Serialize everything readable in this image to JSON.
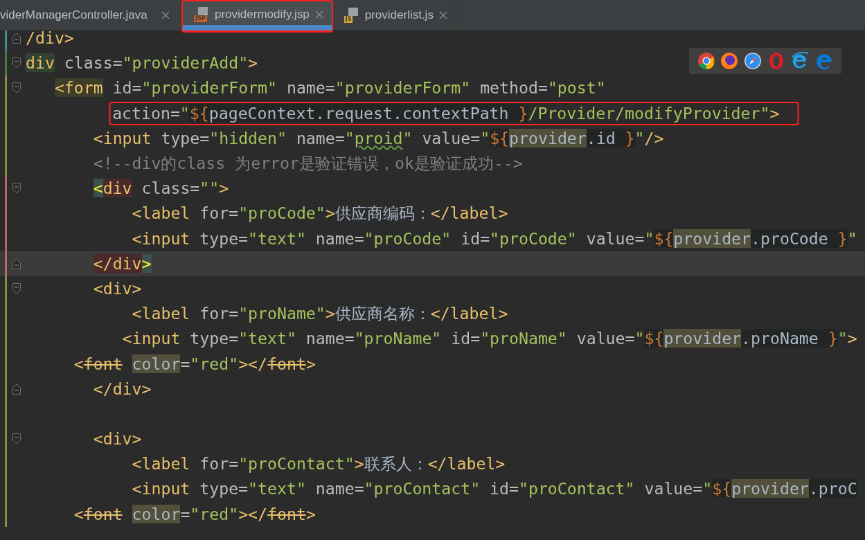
{
  "tabs": [
    {
      "label": "viderManagerController.java",
      "selected": false,
      "annotated": false
    },
    {
      "label": "providermodify.jsp",
      "icon_label": "JSP",
      "color": "#c8602a",
      "selected": true,
      "annotated": true
    },
    {
      "label": "providerlist.js",
      "icon_label": "JS",
      "color": "#d9a63a",
      "selected": false,
      "annotated": false
    }
  ],
  "lines": [
    {
      "kind": "code",
      "color": "#3e8f8f",
      "fold_start": false,
      "fold_end": true,
      "current": false,
      "annotated": false,
      "tokens": [
        {
          "kind": "tag",
          "text": "/div>"
        }
      ]
    },
    {
      "kind": "code",
      "color": "#4a7a45",
      "fold_start": true,
      "fold_end": false,
      "current": false,
      "annotated": false,
      "tokens": [
        {
          "kind": "tagsel",
          "text": "div"
        },
        {
          "kind": "attr",
          "text": " class="
        },
        {
          "kind": "str",
          "text": "\"providerAdd\""
        },
        {
          "kind": "tag",
          "text": ">"
        }
      ]
    },
    {
      "kind": "code",
      "color": "#8d8a4a",
      "fold_start": true,
      "fold_end": false,
      "current": false,
      "annotated": false,
      "tokens": [
        {
          "kind": "tagmark",
          "text": "<form"
        },
        {
          "kind": "attr",
          "text": " id="
        },
        {
          "kind": "str",
          "text": "\"providerForm\""
        },
        {
          "kind": "attr",
          "text": " name="
        },
        {
          "kind": "str",
          "text": "\"providerForm\""
        },
        {
          "kind": "attr",
          "text": " method="
        },
        {
          "kind": "str",
          "text": "\"post\""
        }
      ]
    },
    {
      "kind": "code",
      "color": "#8d8a4a",
      "fold_start": false,
      "fold_end": false,
      "current": false,
      "annotated": true,
      "tokens": [
        {
          "kind": "attr",
          "text": "action="
        },
        {
          "kind": "str",
          "text": "\""
        },
        {
          "kind": "elb",
          "text": "${"
        },
        {
          "kind": "eli",
          "text": "pageContext.request.contextPath "
        },
        {
          "kind": "elb",
          "text": "}"
        },
        {
          "kind": "str",
          "text": "/Provider/modifyProvider\""
        },
        {
          "kind": "tag",
          "text": ">"
        }
      ]
    },
    {
      "kind": "code",
      "color": "#8d8a4a",
      "fold_start": false,
      "fold_end": false,
      "current": false,
      "annotated": false,
      "tokens": [
        {
          "kind": "tag",
          "text": "<input"
        },
        {
          "kind": "attr",
          "text": " type="
        },
        {
          "kind": "str",
          "text": "\"hidden\""
        },
        {
          "kind": "attr",
          "text": " name="
        },
        {
          "kind": "str",
          "text": "\""
        },
        {
          "kind": "typo",
          "text": "proid"
        },
        {
          "kind": "str",
          "text": "\""
        },
        {
          "kind": "attr",
          "text": " value="
        },
        {
          "kind": "str",
          "text": "\""
        },
        {
          "kind": "elb",
          "text": "${"
        },
        {
          "kind": "use",
          "text": "provider"
        },
        {
          "kind": "eli",
          "text": ".id "
        },
        {
          "kind": "elb",
          "text": "}"
        },
        {
          "kind": "str",
          "text": "\""
        },
        {
          "kind": "tag",
          "text": "/>"
        }
      ]
    },
    {
      "kind": "code",
      "color": "#8d8a4a",
      "fold_start": false,
      "fold_end": false,
      "current": false,
      "annotated": false,
      "tokens": [
        {
          "kind": "cmt",
          "text": "<!--div的class 为error是验证错误，ok是验证成功-->"
        }
      ]
    },
    {
      "kind": "code",
      "color": "#b06a6a",
      "fold_start": true,
      "fold_end": false,
      "current": false,
      "annotated": false,
      "tokens": [
        {
          "kind": "matchb",
          "text": "<"
        },
        {
          "kind": "matchn",
          "text": "div"
        },
        {
          "kind": "attr",
          "text": " class="
        },
        {
          "kind": "str",
          "text": "\"\""
        },
        {
          "kind": "tag",
          "text": ">"
        }
      ]
    },
    {
      "kind": "code",
      "color": "#b06a6a",
      "fold_start": false,
      "fold_end": false,
      "current": false,
      "annotated": false,
      "tokens": [
        {
          "kind": "tag",
          "text": "<label"
        },
        {
          "kind": "attr",
          "text": " for="
        },
        {
          "kind": "str",
          "text": "\"proCode\""
        },
        {
          "kind": "tag",
          "text": ">"
        },
        {
          "kind": "txt",
          "text": "供应商编码："
        },
        {
          "kind": "tag",
          "text": "</label>"
        }
      ]
    },
    {
      "kind": "code",
      "color": "#b06a6a",
      "fold_start": false,
      "fold_end": false,
      "current": false,
      "annotated": false,
      "tokens": [
        {
          "kind": "tag",
          "text": "<input"
        },
        {
          "kind": "attr",
          "text": " type="
        },
        {
          "kind": "str",
          "text": "\"text\""
        },
        {
          "kind": "attr",
          "text": " name="
        },
        {
          "kind": "str",
          "text": "\"proCode\""
        },
        {
          "kind": "attr",
          "text": " id="
        },
        {
          "kind": "str",
          "text": "\"proCode\""
        },
        {
          "kind": "attr",
          "text": " value="
        },
        {
          "kind": "str",
          "text": "\""
        },
        {
          "kind": "elb",
          "text": "${"
        },
        {
          "kind": "use",
          "text": "provider"
        },
        {
          "kind": "eli",
          "text": ".proCode "
        },
        {
          "kind": "elb",
          "text": "}"
        },
        {
          "kind": "str",
          "text": "\""
        }
      ]
    },
    {
      "kind": "code",
      "color": "#b06a6a",
      "fold_start": false,
      "fold_end": true,
      "current": true,
      "annotated": false,
      "tokens": [
        {
          "kind": "matchn",
          "text": "</div"
        },
        {
          "kind": "matchb",
          "text": ">"
        }
      ]
    },
    {
      "kind": "code",
      "color": "#8d8a4a",
      "fold_start": true,
      "fold_end": false,
      "current": false,
      "annotated": false,
      "tokens": [
        {
          "kind": "tag",
          "text": "<div>"
        }
      ]
    },
    {
      "kind": "code",
      "color": "#8d8a4a",
      "fold_start": false,
      "fold_end": false,
      "current": false,
      "annotated": false,
      "tokens": [
        {
          "kind": "tag",
          "text": "<label"
        },
        {
          "kind": "attr",
          "text": " for="
        },
        {
          "kind": "str",
          "text": "\"proName\""
        },
        {
          "kind": "tag",
          "text": ">"
        },
        {
          "kind": "txt",
          "text": "供应商名称："
        },
        {
          "kind": "tag",
          "text": "</label>"
        }
      ]
    },
    {
      "kind": "code",
      "color": "#8d8a4a",
      "fold_start": false,
      "fold_end": false,
      "current": false,
      "annotated": false,
      "tokens": [
        {
          "kind": "tag",
          "text": "<input"
        },
        {
          "kind": "attr",
          "text": " type="
        },
        {
          "kind": "str",
          "text": "\"text\""
        },
        {
          "kind": "attr",
          "text": " name="
        },
        {
          "kind": "str",
          "text": "\"proName\""
        },
        {
          "kind": "attr",
          "text": " id="
        },
        {
          "kind": "str",
          "text": "\"proName\""
        },
        {
          "kind": "attr",
          "text": " value="
        },
        {
          "kind": "str",
          "text": "\""
        },
        {
          "kind": "elb",
          "text": "${"
        },
        {
          "kind": "use",
          "text": "provider"
        },
        {
          "kind": "eli",
          "text": ".proName "
        },
        {
          "kind": "elb",
          "text": "}"
        },
        {
          "kind": "str",
          "text": "\""
        },
        {
          "kind": "tag",
          "text": ">"
        }
      ]
    },
    {
      "kind": "code",
      "color": "#8d8a4a",
      "fold_start": false,
      "fold_end": false,
      "current": false,
      "annotated": false,
      "tokens": [
        {
          "kind": "tag",
          "text": "<"
        },
        {
          "kind": "dep",
          "text": "font"
        },
        {
          "kind": "use",
          "text": "color"
        },
        {
          "kind": "attr",
          "text": "="
        },
        {
          "kind": "str",
          "text": "\"red\""
        },
        {
          "kind": "tag",
          "text": "></"
        },
        {
          "kind": "dep",
          "text": "font"
        },
        {
          "kind": "tag",
          "text": ">"
        }
      ]
    },
    {
      "kind": "code",
      "color": "#8d8a4a",
      "fold_start": false,
      "fold_end": true,
      "current": false,
      "annotated": false,
      "tokens": [
        {
          "kind": "tag",
          "text": "</div>"
        }
      ]
    },
    {
      "kind": "blank",
      "color": "#8d8a4a"
    },
    {
      "kind": "code",
      "color": "#8d8a4a",
      "fold_start": true,
      "fold_end": false,
      "current": false,
      "annotated": false,
      "tokens": [
        {
          "kind": "tag",
          "text": "<div>"
        }
      ]
    },
    {
      "kind": "code",
      "color": "#8d8a4a",
      "fold_start": false,
      "fold_end": false,
      "current": false,
      "annotated": false,
      "tokens": [
        {
          "kind": "tag",
          "text": "<label"
        },
        {
          "kind": "attr",
          "text": " for="
        },
        {
          "kind": "str",
          "text": "\"proContact\""
        },
        {
          "kind": "tag",
          "text": ">"
        },
        {
          "kind": "txt",
          "text": "联系人："
        },
        {
          "kind": "tag",
          "text": "</label>"
        }
      ]
    },
    {
      "kind": "code",
      "color": "#8d8a4a",
      "fold_start": false,
      "fold_end": false,
      "current": false,
      "annotated": false,
      "tokens": [
        {
          "kind": "tag",
          "text": "<input"
        },
        {
          "kind": "attr",
          "text": " type="
        },
        {
          "kind": "str",
          "text": "\"text\""
        },
        {
          "kind": "attr",
          "text": " name="
        },
        {
          "kind": "str",
          "text": "\"proContact\""
        },
        {
          "kind": "attr",
          "text": " id="
        },
        {
          "kind": "str",
          "text": "\"proContact\""
        },
        {
          "kind": "attr",
          "text": " value="
        },
        {
          "kind": "str",
          "text": "\""
        },
        {
          "kind": "elb",
          "text": "${"
        },
        {
          "kind": "use",
          "text": "provider"
        },
        {
          "kind": "eli",
          "text": ".proC"
        }
      ]
    },
    {
      "kind": "code",
      "color": "#8d8a4a",
      "fold_start": false,
      "fold_end": false,
      "current": false,
      "annotated": false,
      "tokens": [
        {
          "kind": "tag",
          "text": "<"
        },
        {
          "kind": "dep",
          "text": "font"
        },
        {
          "kind": "use",
          "text": "color"
        },
        {
          "kind": "attr",
          "text": "="
        },
        {
          "kind": "str",
          "text": "\"red\""
        },
        {
          "kind": "tag",
          "text": "></"
        },
        {
          "kind": "dep",
          "text": "font"
        },
        {
          "kind": "tag",
          "text": ">"
        }
      ]
    }
  ]
}
